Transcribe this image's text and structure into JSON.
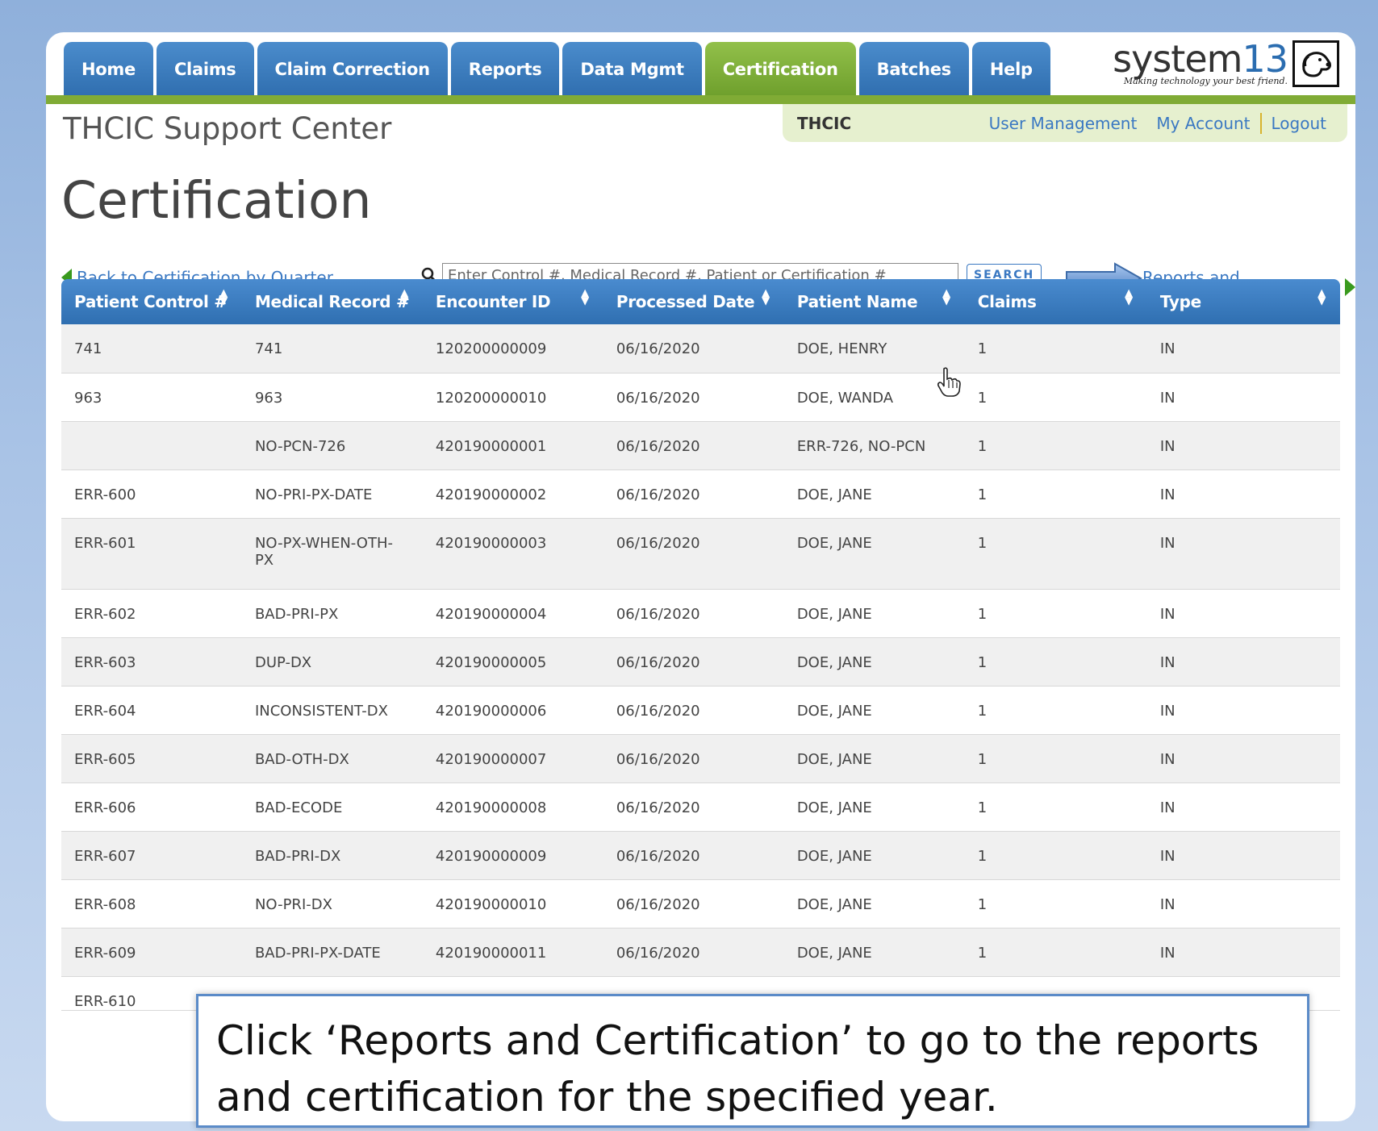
{
  "nav": {
    "tabs": [
      "Home",
      "Claims",
      "Claim Correction",
      "Reports",
      "Data Mgmt",
      "Certification",
      "Batches",
      "Help"
    ],
    "active_tab": "Certification"
  },
  "logo": {
    "word_prefix": "system",
    "word_suffix": "13",
    "tagline": "Making technology your best friend."
  },
  "subbar": {
    "org": "THCIC",
    "links": [
      "User Management",
      "My Account",
      "Logout"
    ]
  },
  "site_title": "THCIC Support Center",
  "page_title": "Certification",
  "back_link": "Back to Certification by Quarter",
  "search": {
    "placeholder": "Enter Control #, Medical Record #, Patient or Certification #",
    "button_label": "SEARCH"
  },
  "reports_link": "Reports and Certification",
  "table": {
    "columns": [
      "Patient Control #",
      "Medical Record #",
      "Encounter ID",
      "Processed Date",
      "Patient Name",
      "Claims",
      "Type"
    ],
    "rows": [
      [
        "741",
        "741",
        "120200000009",
        "06/16/2020",
        "DOE, HENRY",
        "1",
        "IN"
      ],
      [
        "963",
        "963",
        "120200000010",
        "06/16/2020",
        "DOE, WANDA",
        "1",
        "IN"
      ],
      [
        "",
        "NO-PCN-726",
        "420190000001",
        "06/16/2020",
        "ERR-726, NO-PCN",
        "1",
        "IN"
      ],
      [
        "ERR-600",
        "NO-PRI-PX-DATE",
        "420190000002",
        "06/16/2020",
        "DOE, JANE",
        "1",
        "IN"
      ],
      [
        "ERR-601",
        "NO-PX-WHEN-OTH-PX",
        "420190000003",
        "06/16/2020",
        "DOE, JANE",
        "1",
        "IN"
      ],
      [
        "ERR-602",
        "BAD-PRI-PX",
        "420190000004",
        "06/16/2020",
        "DOE, JANE",
        "1",
        "IN"
      ],
      [
        "ERR-603",
        "DUP-DX",
        "420190000005",
        "06/16/2020",
        "DOE, JANE",
        "1",
        "IN"
      ],
      [
        "ERR-604",
        "INCONSISTENT-DX",
        "420190000006",
        "06/16/2020",
        "DOE, JANE",
        "1",
        "IN"
      ],
      [
        "ERR-605",
        "BAD-OTH-DX",
        "420190000007",
        "06/16/2020",
        "DOE, JANE",
        "1",
        "IN"
      ],
      [
        "ERR-606",
        "BAD-ECODE",
        "420190000008",
        "06/16/2020",
        "DOE, JANE",
        "1",
        "IN"
      ],
      [
        "ERR-607",
        "BAD-PRI-DX",
        "420190000009",
        "06/16/2020",
        "DOE, JANE",
        "1",
        "IN"
      ],
      [
        "ERR-608",
        "NO-PRI-DX",
        "420190000010",
        "06/16/2020",
        "DOE, JANE",
        "1",
        "IN"
      ],
      [
        "ERR-609",
        "BAD-PRI-PX-DATE",
        "420190000011",
        "06/16/2020",
        "DOE, JANE",
        "1",
        "IN"
      ],
      [
        "ERR-610",
        "",
        "",
        "",
        "",
        "",
        ""
      ]
    ]
  },
  "callout": "Click ‘Reports and Certification’  to go to the reports and certification for the specified year.",
  "colors": {
    "nav_blue": "#2f6eaf",
    "nav_active_green": "#80ab35",
    "link_blue": "#3a78c2",
    "subbar_bg": "#e6f0cf"
  }
}
